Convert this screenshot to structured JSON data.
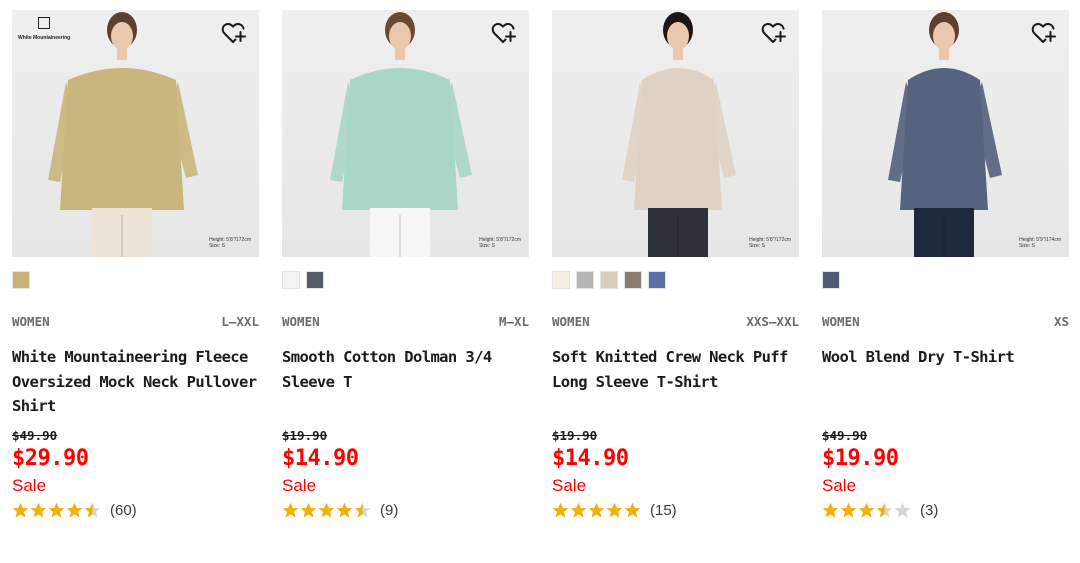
{
  "products": [
    {
      "has_logo": true,
      "logo_text": "White Mountaineering",
      "model_info": [
        "Height: 5'8\"/172cm",
        "Size: S"
      ],
      "garment_color": "#c9b67c",
      "bottom_color": "#ece4d6",
      "hair_color": "#5a4030",
      "swatches": [
        "#c9b07a"
      ],
      "gender": "WOMEN",
      "size_range": "L–XXL",
      "name": "White Mountaineering Fleece Oversized Mock Neck Pullover Shirt",
      "original_price": "$49.90",
      "sale_price": "$29.90",
      "sale_label": "Sale",
      "rating": 4.5,
      "review_count": "(60)"
    },
    {
      "has_logo": false,
      "model_info": [
        "Height: 5'8\"/172cm",
        "Size: S"
      ],
      "garment_color": "#a9d6c6",
      "bottom_color": "#f7f7f4",
      "hair_color": "#6b4a34",
      "swatches": [
        "#f3f3f3",
        "#555a63"
      ],
      "gender": "WOMEN",
      "size_range": "M–XL",
      "name": "Smooth Cotton Dolman 3/4 Sleeve T",
      "original_price": "$19.90",
      "sale_price": "$14.90",
      "sale_label": "Sale",
      "rating": 4.5,
      "review_count": "(9)"
    },
    {
      "has_logo": false,
      "model_info": [
        "Height: 5'8\"/172cm",
        "Size: S"
      ],
      "garment_color": "#dfd2c4",
      "bottom_color": "#2e3138",
      "hair_color": "#1c1614",
      "swatches": [
        "#f4efe3",
        "#b5b5b5",
        "#d8cdbd",
        "#8a7b6c",
        "#5b6fa6"
      ],
      "gender": "WOMEN",
      "size_range": "XXS–XXL",
      "name": "Soft Knitted Crew Neck Puff Long Sleeve T-Shirt",
      "original_price": "$19.90",
      "sale_price": "$14.90",
      "sale_label": "Sale",
      "rating": 5,
      "review_count": "(15)"
    },
    {
      "has_logo": false,
      "model_info": [
        "Height: 5'9\"/174cm",
        "Size: S"
      ],
      "garment_color": "#56637f",
      "bottom_color": "#20283d",
      "hair_color": "#5e4030",
      "swatches": [
        "#4e5976"
      ],
      "gender": "WOMEN",
      "size_range": "XS",
      "name": "Wool Blend Dry T-Shirt",
      "original_price": "$49.90",
      "sale_price": "$19.90",
      "sale_label": "Sale",
      "rating": 3.5,
      "review_count": "(3)"
    }
  ],
  "colors": {
    "sale_red": "#ff0000",
    "star_gold": "#f2b000",
    "star_empty": "#d6d6d6"
  },
  "icons": {
    "wishlist": "heart-plus-icon",
    "star": "star-icon"
  }
}
